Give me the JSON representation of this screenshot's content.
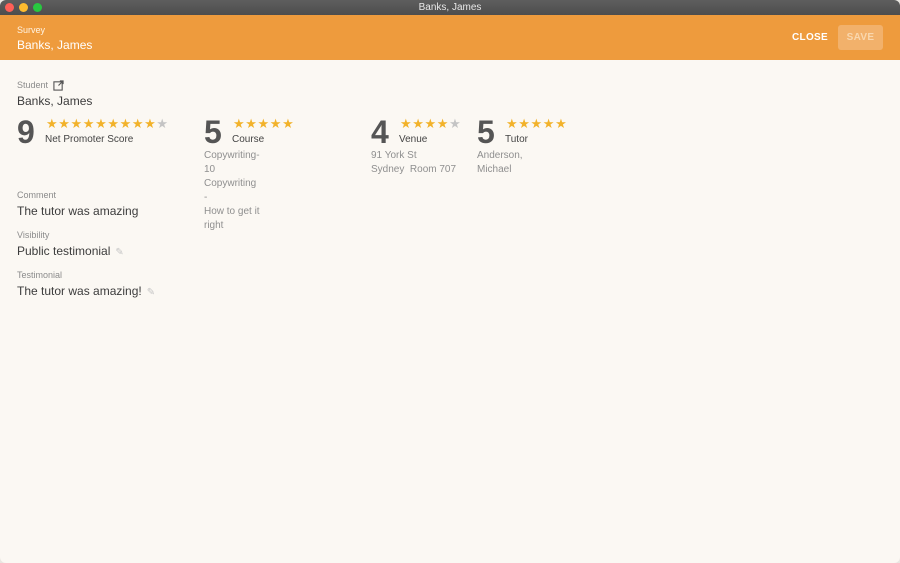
{
  "window": {
    "title": "Banks, James"
  },
  "header": {
    "kicker": "Survey",
    "title": "Banks, James",
    "close_label": "CLOSE",
    "save_label": "SAVE"
  },
  "student": {
    "label": "Student",
    "name": "Banks, James"
  },
  "metrics": [
    {
      "score": "9",
      "label": "Net Promoter Score",
      "rating": 9,
      "max": 10,
      "sub": []
    },
    {
      "score": "5",
      "label": "Course",
      "rating": 5,
      "max": 5,
      "sub": [
        "Copywriting-10 Copywriting -",
        "How to get it right"
      ]
    },
    {
      "score": "4",
      "label": "Venue",
      "rating": 4,
      "max": 5,
      "sub": [
        "91 York St",
        "Sydney  Room 707"
      ]
    },
    {
      "score": "5",
      "label": "Tutor",
      "rating": 5,
      "max": 5,
      "sub": [
        "Anderson,",
        "Michael"
      ]
    }
  ],
  "comment": {
    "label": "Comment",
    "value": "The tutor was amazing"
  },
  "visibility": {
    "label": "Visibility",
    "value": "Public testimonial"
  },
  "testimonial": {
    "label": "Testimonial",
    "value": "The tutor was amazing!"
  },
  "colors": {
    "accent": "#ee9b3d",
    "star": "#f2b22a",
    "star_off": "#c4c4c4"
  }
}
